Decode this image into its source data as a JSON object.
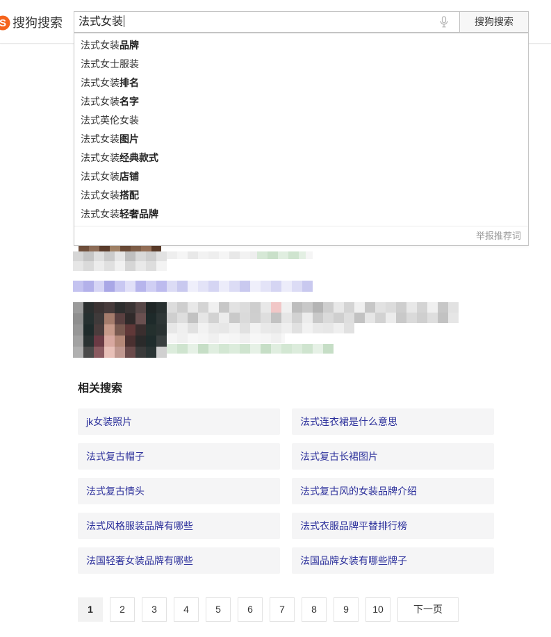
{
  "header": {
    "logo_mark": "S",
    "logo_text": "搜狗搜索",
    "search": {
      "value": "法式女装",
      "button_label": "搜狗搜索"
    }
  },
  "icons": {
    "logo": "sogou-logo-icon",
    "voice_search": "microphone-icon"
  },
  "suggestions": {
    "items": [
      {
        "text": "法式女装",
        "bold": "品牌"
      },
      {
        "text": "法式女士服装"
      },
      {
        "text": "法式女装",
        "bold": "排名"
      },
      {
        "text": "法式女装",
        "bold": "名字"
      },
      {
        "text": "法式英伦女装"
      },
      {
        "text": "法式女装",
        "bold": "图片"
      },
      {
        "text": "法式女装",
        "bold": "经典款式"
      },
      {
        "text": "法式女装",
        "bold": "店铺"
      },
      {
        "text": "法式女装",
        "bold": "搭配"
      },
      {
        "text": "法式女装",
        "bold": "轻奢品牌"
      }
    ],
    "report_label": "举报推荐词"
  },
  "related": {
    "title": "相关搜索",
    "items": [
      "jk女装照片",
      "法式连衣裙是什么意思",
      "法式复古帽子",
      "法式复古长裙图片",
      "法式复古情头",
      "法式复古风的女装品牌介绍",
      "法式风格服装品牌有哪些",
      "法式衣服品牌平替排行榜",
      "法国轻奢女装品牌有哪些",
      "法国品牌女装有哪些牌子"
    ]
  },
  "pagination": {
    "pages": [
      {
        "label": "1",
        "current": true
      },
      {
        "label": "2"
      },
      {
        "label": "3"
      },
      {
        "label": "4"
      },
      {
        "label": "5"
      },
      {
        "label": "6"
      },
      {
        "label": "7"
      },
      {
        "label": "8"
      },
      {
        "label": "9"
      },
      {
        "label": "10"
      }
    ],
    "next_label": "下一页"
  },
  "colors": {
    "brand": "#f5631c",
    "link": "#2b2f9b"
  }
}
